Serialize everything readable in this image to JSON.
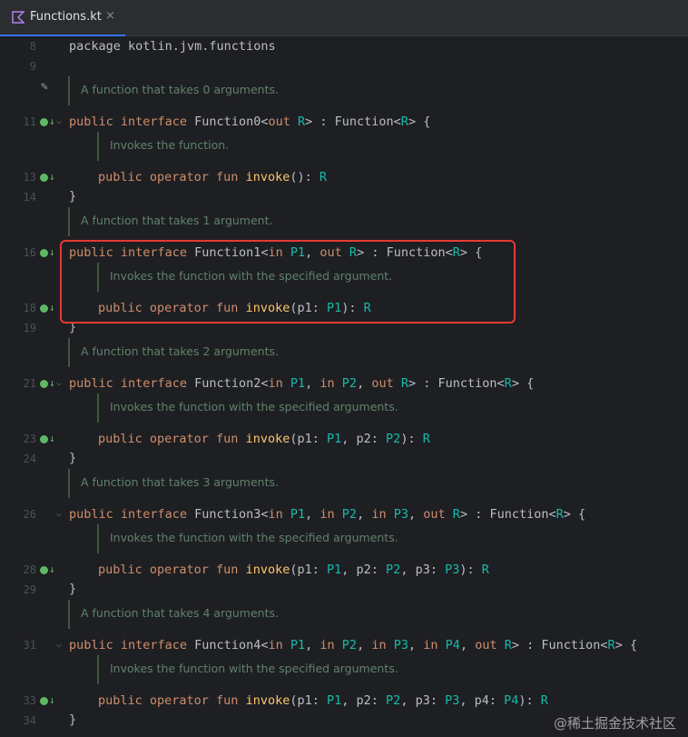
{
  "tab": {
    "title": "Functions.kt",
    "close_icon": "×"
  },
  "lines": {
    "l8": "8",
    "l9": "9",
    "l11": "11",
    "l13": "13",
    "l14": "14",
    "l16": "16",
    "l18": "18",
    "l19": "19",
    "l21": "21",
    "l23": "23",
    "l24": "24",
    "l26": "26",
    "l28": "28",
    "l29": "29",
    "l31": "31",
    "l33": "33",
    "l34": "34"
  },
  "code": {
    "package": "package kotlin.jvm.functions",
    "docs": [
      "A function that takes 0 arguments.",
      "Invokes the function.",
      "A function that takes 1 argument.",
      "Invokes the function with the specified argument.",
      "A function that takes 2 arguments.",
      "Invokes the function with the specified arguments.",
      "A function that takes 3 arguments.",
      "Invokes the function with the specified arguments.",
      "A function that takes 4 arguments.",
      "Invokes the function with the specified arguments."
    ]
  },
  "watermark": "@稀土掘金技术社区",
  "colors": {
    "keyword": "#cf8e6d",
    "type_param": "#16baac",
    "function_name": "#ffc66d",
    "doc": "#5f826b",
    "highlight": "#e53935"
  }
}
